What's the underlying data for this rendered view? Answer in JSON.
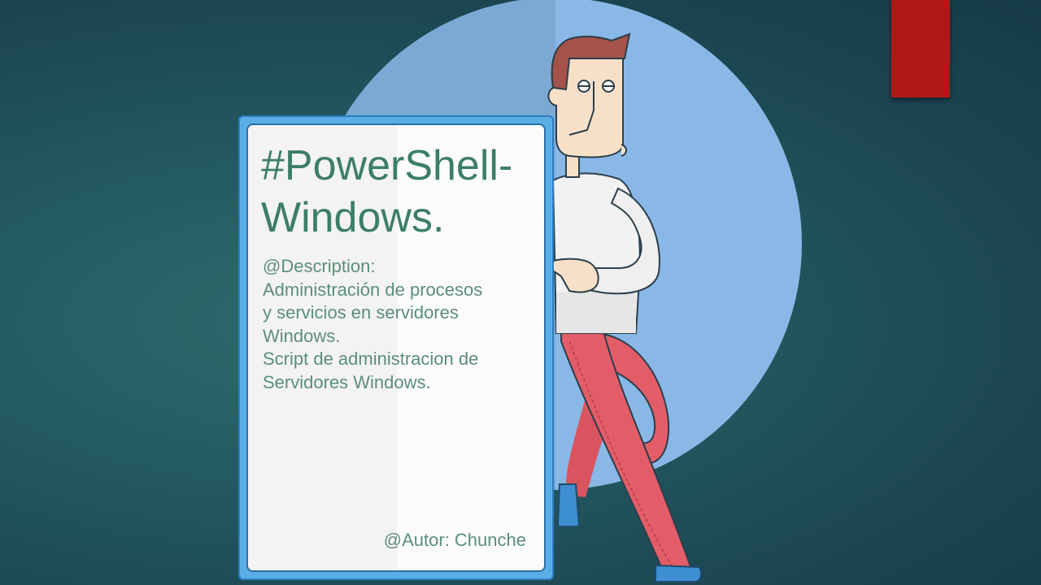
{
  "slide": {
    "title_line1": "#PowerShell-",
    "title_line2": "Windows.",
    "description_label": "@Description:",
    "description_lines": [
      "Administración de procesos",
      "y servicios en servidores",
      "Windows.",
      "Script de administracion de",
      "Servidores Windows."
    ],
    "author": "@Autor: Chunche"
  },
  "colors": {
    "background": "#1f4f5a",
    "accent_tab": "#b01818",
    "circle": "#8ab8e6",
    "card_frame": "#5aaee8",
    "title_text": "#3c7e66",
    "body_text": "#5c8e78"
  },
  "illustration": "cartoon-man-leaning-on-sign"
}
